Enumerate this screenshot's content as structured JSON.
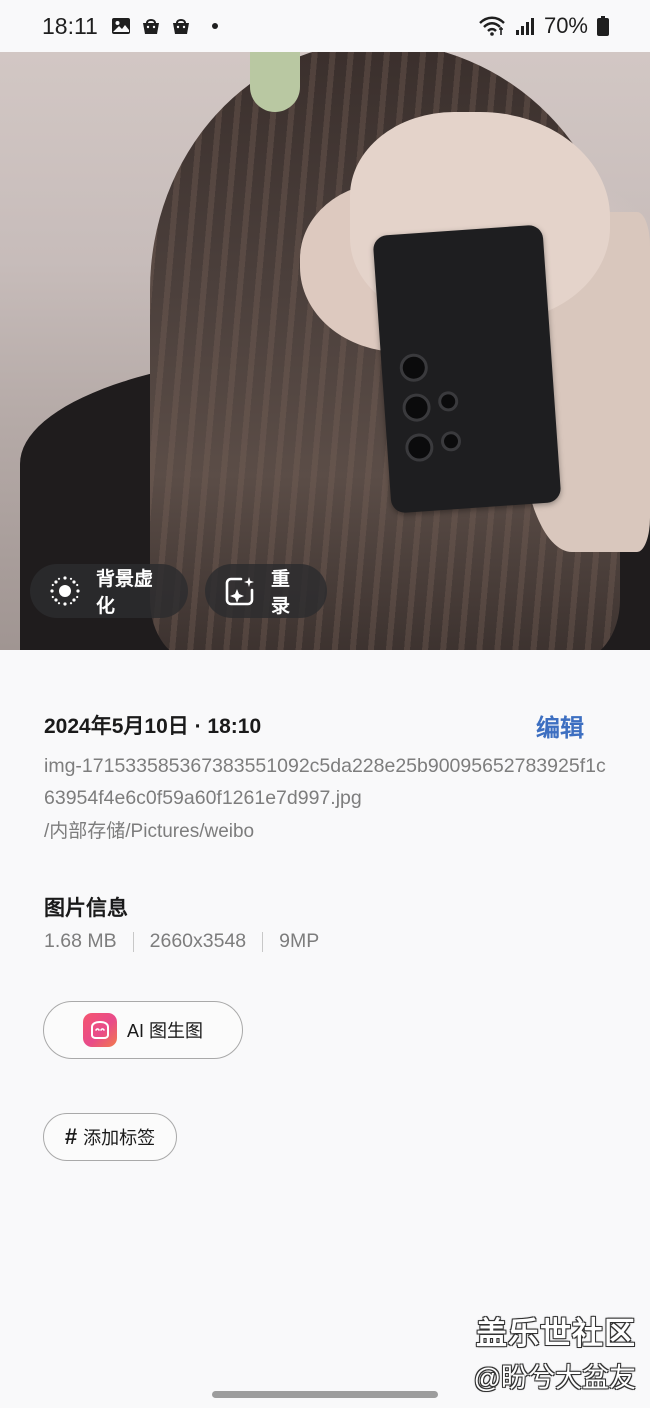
{
  "status_bar": {
    "time": "18:11",
    "battery_percent": "70%",
    "icons": [
      "gallery-icon",
      "shopping-bag-icon",
      "shopping-bag-icon",
      "notification-dot",
      "wifi-icon",
      "signal-icon",
      "battery-icon"
    ]
  },
  "photo": {
    "actions": {
      "bokeh_label": "背景虚化",
      "remake_label": "重录"
    }
  },
  "details": {
    "date_time": "2024年5月10日 · 18:10",
    "edit_label": "编辑",
    "filename": "img-171533585367383551092c5da228e25b90095652783925f1c63954f4e6c0f59a60f1261e7d997.jpg",
    "path": "/内部存储/Pictures/weibo",
    "info_title": "图片信息",
    "file_size": "1.68 MB",
    "resolution": "2660x3548",
    "megapixels": "9MP",
    "ai_button_label": "AI 图生图",
    "add_tag_label": "添加标签",
    "tag_symbol": "#"
  },
  "watermark": {
    "line1": "盖乐世社区",
    "line2": "@盼兮大盆友"
  },
  "colors": {
    "accent": "#3d6fc1",
    "background": "#f9f9fa",
    "secondary_text": "#7d7d7d"
  }
}
